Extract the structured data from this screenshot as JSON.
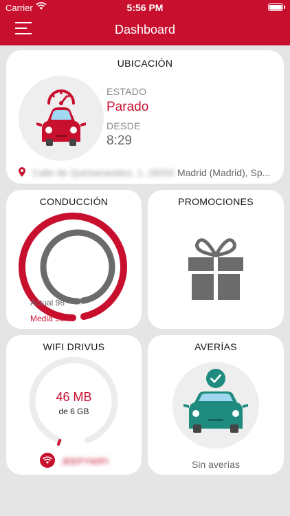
{
  "status_bar": {
    "carrier": "Carrier",
    "time": "5:56 PM"
  },
  "header": {
    "title": "Dashboard",
    "menu_icon": "hamburger-menu-icon",
    "color": "#c8102e"
  },
  "location": {
    "title": "UBICACIÓN",
    "status_label": "ESTADO",
    "status_value": "Parado",
    "since_label": "DESDE",
    "since_value": "8:29",
    "address_street": "Calle de Quintanavides, 1, 28050",
    "address_city": "Madrid (Madrid), Sp..."
  },
  "driving": {
    "title": "CONDUCCIÓN",
    "actual_label": "Actual 98",
    "average_label": "Media 95",
    "actual_value": 98,
    "average_value": 95
  },
  "promotions": {
    "title": "PROMOCIONES",
    "icon": "gift-icon"
  },
  "wifi": {
    "title": "WIFI DRIVUS",
    "usage": "46 MB",
    "total": "de 6 GB",
    "usage_fraction": 0.0075,
    "network_name": "JEEPYWIFI",
    "icon": "wifi-icon"
  },
  "faults": {
    "title": "AVERÍAS",
    "status": "Sin averías",
    "icon": "check-icon"
  },
  "colors": {
    "red": "#c8102e",
    "teal": "#1f8a7e",
    "gray": "#6b6b6b"
  }
}
